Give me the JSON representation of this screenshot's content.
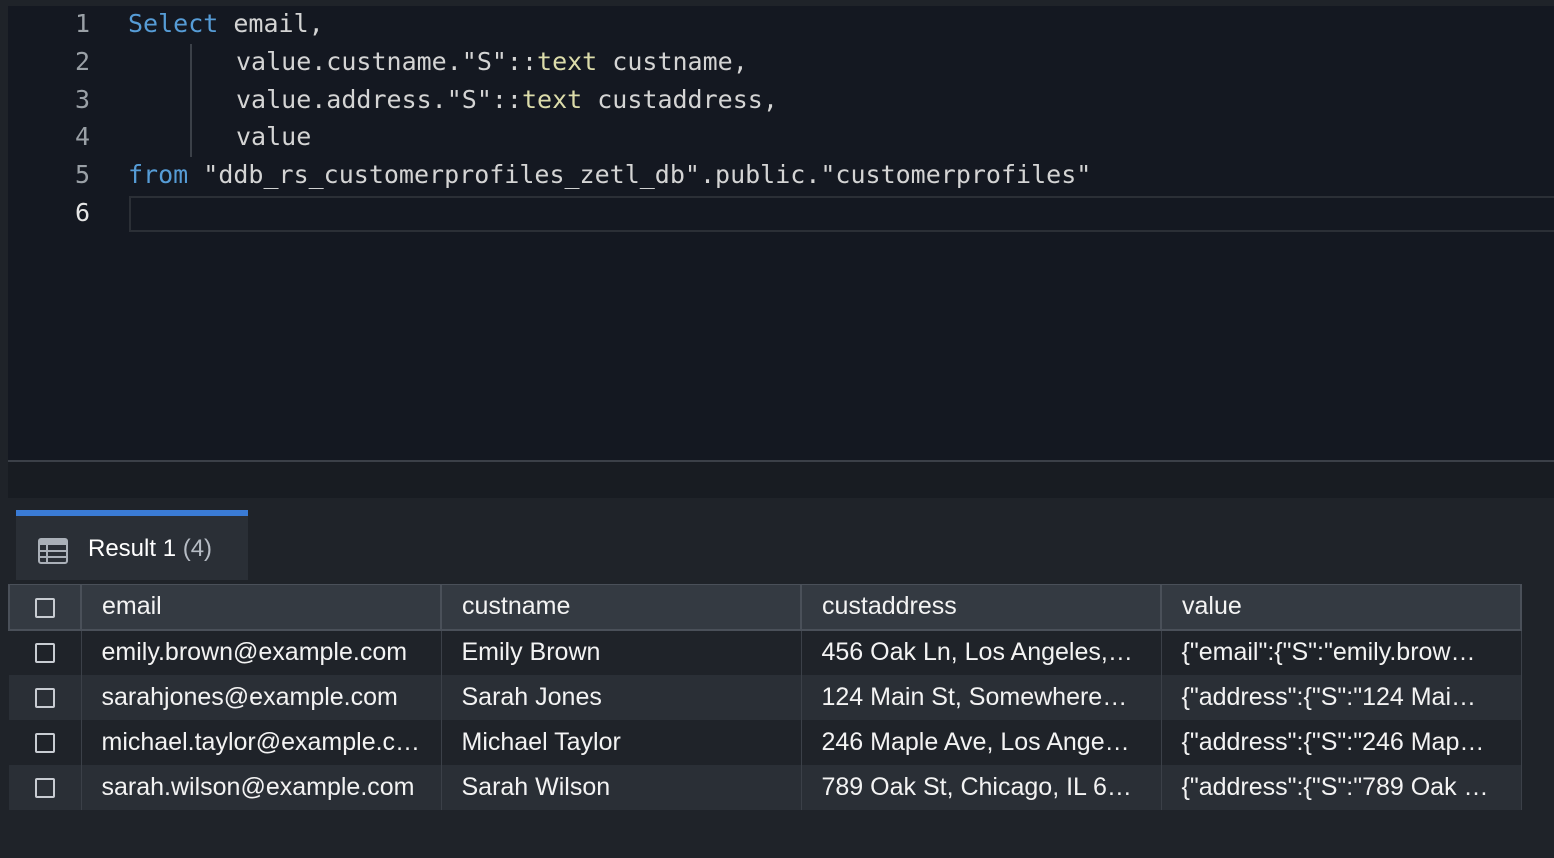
{
  "editor": {
    "lines": [
      {
        "number": "1",
        "tokens": [
          {
            "t": "Select",
            "c": "kw"
          },
          {
            "t": " email,",
            "c": ""
          }
        ]
      },
      {
        "number": "2",
        "tokens": [
          {
            "t": "value.custname.\"S\"::",
            "c": ""
          },
          {
            "t": "text",
            "c": "ty"
          },
          {
            "t": " custname,",
            "c": ""
          }
        ]
      },
      {
        "number": "3",
        "tokens": [
          {
            "t": "value.address.\"S\"::",
            "c": ""
          },
          {
            "t": "text",
            "c": "ty"
          },
          {
            "t": " custaddress,",
            "c": ""
          }
        ]
      },
      {
        "number": "4",
        "tokens": [
          {
            "t": "value",
            "c": ""
          }
        ]
      },
      {
        "number": "5",
        "tokens": [
          {
            "t": "from",
            "c": "kw"
          },
          {
            "t": " \"ddb_rs_customerprofiles_zetl_db\".public.\"customerprofiles\"",
            "c": ""
          }
        ]
      },
      {
        "number": "6",
        "tokens": []
      }
    ]
  },
  "results": {
    "tab_label": "Result 1",
    "tab_count": "(4)",
    "columns": [
      "email",
      "custname",
      "custaddress",
      "value"
    ],
    "rows": [
      [
        "emily.brown@example.com",
        "Emily Brown",
        "456 Oak Ln, Los Angeles,…",
        "{\"email\":{\"S\":\"emily.brow…"
      ],
      [
        "sarahjones@example.com",
        "Sarah Jones",
        "124 Main St, Somewhere…",
        "{\"address\":{\"S\":\"124 Mai…"
      ],
      [
        "michael.taylor@example.c…",
        "Michael Taylor",
        "246 Maple Ave, Los Ange…",
        "{\"address\":{\"S\":\"246 Map…"
      ],
      [
        "sarah.wilson@example.com",
        "Sarah Wilson",
        "789 Oak St, Chicago, IL 6…",
        "{\"address\":{\"S\":\"789 Oak …"
      ]
    ]
  },
  "colors": {
    "keyword": "#569cd6",
    "type": "#dcdcaa",
    "tab_accent": "#3a7bd5"
  },
  "icons": {
    "result_tab": "table-icon"
  }
}
